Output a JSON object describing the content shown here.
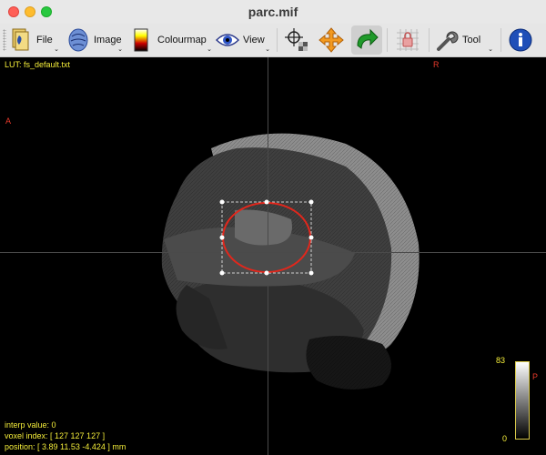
{
  "window": {
    "title": "parc.mif"
  },
  "toolbar": {
    "file_label": "File",
    "image_label": "Image",
    "colourmap_label": "Colourmap",
    "view_label": "View",
    "tool_label": "Tool",
    "caret": "⌄"
  },
  "overlay": {
    "lut": "LUT: fs_default.txt",
    "orient_right": "R",
    "orient_anterior": "A",
    "orient_posterior": "P",
    "colorbar_max": "83",
    "colorbar_min": "0",
    "interp_value": "interp value: 0",
    "voxel_index": "voxel index: [ 127 127 127 ]",
    "position": "position: [ 3.89 11.53 -4.424 ] mm"
  },
  "colors": {
    "overlay_text": "#f5ee3a",
    "orientation_text": "#e83a2b",
    "roi_ellipse": "#e1271c",
    "viewer_bg": "#000000"
  },
  "icons": [
    "file-icon",
    "image-icon",
    "colourmap-icon",
    "view-icon",
    "crosshair-icon",
    "move-icon",
    "rotate-icon",
    "lock-icon",
    "tool-icon",
    "info-icon"
  ]
}
